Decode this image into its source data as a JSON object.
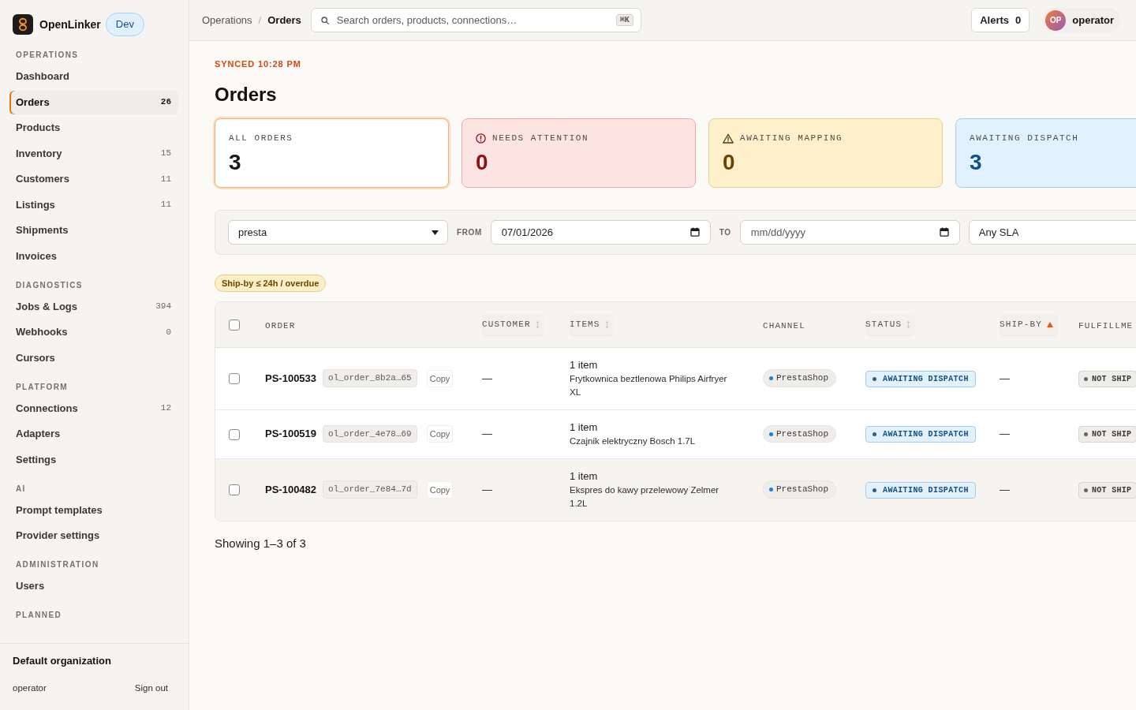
{
  "brand": {
    "name": "OpenLinker",
    "environment": "Dev"
  },
  "sidebar": {
    "sections": [
      {
        "heading": "OPERATIONS",
        "items": [
          {
            "label": "Dashboard",
            "selected": false
          },
          {
            "label": "Orders",
            "count": "26",
            "selected": true
          },
          {
            "label": "Products",
            "selected": false
          },
          {
            "label": "Inventory",
            "count": "15",
            "selected": false
          },
          {
            "label": "Customers",
            "count": "11",
            "selected": false
          },
          {
            "label": "Listings",
            "count": "11",
            "selected": false
          },
          {
            "label": "Shipments",
            "selected": false
          },
          {
            "label": "Invoices",
            "selected": false
          }
        ]
      },
      {
        "heading": "DIAGNOSTICS",
        "items": [
          {
            "label": "Jobs & Logs",
            "count": "394",
            "selected": false
          },
          {
            "label": "Webhooks",
            "count": "0",
            "selected": false
          },
          {
            "label": "Cursors",
            "selected": false
          }
        ]
      },
      {
        "heading": "PLATFORM",
        "items": [
          {
            "label": "Connections",
            "count": "12",
            "selected": false
          },
          {
            "label": "Adapters",
            "selected": false
          },
          {
            "label": "Settings",
            "selected": false
          }
        ]
      },
      {
        "heading": "AI",
        "items": [
          {
            "label": "Prompt templates",
            "selected": false
          },
          {
            "label": "Provider settings",
            "selected": false
          }
        ]
      },
      {
        "heading": "ADMINISTRATION",
        "items": [
          {
            "label": "Users",
            "selected": false
          }
        ]
      },
      {
        "heading": "PLANNED"
      }
    ],
    "footer": {
      "organization": "Default organization",
      "user": "operator",
      "sign_out": "Sign out"
    }
  },
  "topbar": {
    "breadcrumb": {
      "items": [
        {
          "label": "Operations",
          "selected": false
        },
        {
          "label": "Orders",
          "selected": true
        }
      ],
      "separator": "/"
    },
    "search": {
      "placeholder": "Search orders, products, connections…",
      "shortcut": "⌘K"
    },
    "alerts": {
      "label": "Alerts",
      "count": "0"
    },
    "user": {
      "initials": "OP",
      "name": "operator"
    }
  },
  "page": {
    "sync_status": "SYNCED 10:28 PM",
    "title": "Orders"
  },
  "stat_cards": [
    {
      "label": "ALL ORDERS",
      "value": "3",
      "kind": "neutral",
      "selected": true
    },
    {
      "label": "NEEDS ATTENTION",
      "value": "0",
      "kind": "danger",
      "selected": false
    },
    {
      "label": "AWAITING MAPPING",
      "value": "0",
      "kind": "warning",
      "selected": false
    },
    {
      "label": "AWAITING DISPATCH",
      "value": "3",
      "kind": "info",
      "selected": false
    }
  ],
  "filters": {
    "channel": {
      "value": "presta"
    },
    "from": {
      "label": "FROM",
      "value": "07/01/2026"
    },
    "to": {
      "label": "TO",
      "placeholder": "mm/dd/yyyy"
    },
    "sla": {
      "value": "Any SLA"
    }
  },
  "active_filters": [
    {
      "label": "Ship-by ≤ 24h / overdue"
    }
  ],
  "table": {
    "select_all": {
      "checked": false
    },
    "columns": [
      {
        "label": "ORDER",
        "sortable": false,
        "sorted": false
      },
      {
        "label": "CUSTOMER",
        "sortable": true,
        "sorted": false
      },
      {
        "label": "ITEMS",
        "sortable": true,
        "sorted": false
      },
      {
        "label": "CHANNEL",
        "sortable": false,
        "sorted": false
      },
      {
        "label": "STATUS",
        "sortable": true,
        "sorted": false
      },
      {
        "label": "SHIP-BY",
        "sortable": true,
        "sorted": true
      },
      {
        "label": "FULFILLME",
        "sortable": false,
        "sorted": false
      }
    ],
    "rows": [
      {
        "checked": false,
        "hovered": false,
        "order": "PS-100533",
        "reference": "ol_order_8b2a…65",
        "copy": "Copy",
        "customer": "—",
        "items_count": "1 item",
        "items_name": "Frytkownica beztlenowa Philips Airfryer XL",
        "channel": "PrestaShop",
        "status": "AWAITING DISPATCH",
        "ship_by": "—",
        "fulfillment": "NOT SHIP"
      },
      {
        "checked": false,
        "hovered": false,
        "order": "PS-100519",
        "reference": "ol_order_4e78…69",
        "copy": "Copy",
        "customer": "—",
        "items_count": "1 item",
        "items_name": "Czajnik elektryczny Bosch 1.7L",
        "channel": "PrestaShop",
        "status": "AWAITING DISPATCH",
        "ship_by": "—",
        "fulfillment": "NOT SHIP"
      },
      {
        "checked": false,
        "hovered": true,
        "order": "PS-100482",
        "reference": "ol_order_7e84…7d",
        "copy": "Copy",
        "customer": "—",
        "items_count": "1 item",
        "items_name": "Ekspres do kawy przelewowy Zelmer 1.2L",
        "channel": "PrestaShop",
        "status": "AWAITING DISPATCH",
        "ship_by": "—",
        "fulfillment": "NOT SHIP"
      }
    ]
  },
  "pagination": {
    "summary": "Showing 1–3 of 3"
  }
}
